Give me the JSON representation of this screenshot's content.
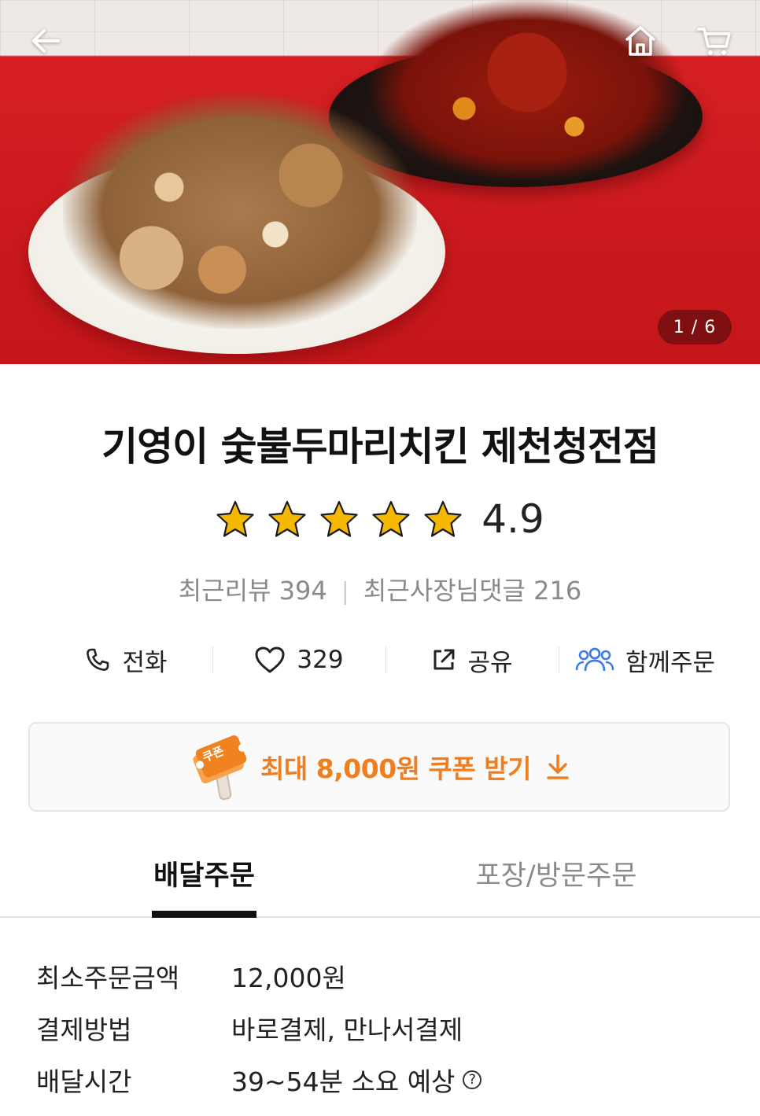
{
  "header": {
    "back_icon": "arrow-left-icon",
    "home_icon": "home-icon",
    "cart_icon": "cart-icon",
    "pager": "1 / 6"
  },
  "store": {
    "name": "기영이 숯불두마리치킨 제천청전점",
    "rating": "4.9",
    "rating_stars": 5,
    "review_label": "최근리뷰 394",
    "owner_reply_label": "최근사장님댓글 216"
  },
  "actions": {
    "call": "전화",
    "like_count": "329",
    "share": "공유",
    "group_order": "함께주문"
  },
  "coupon": {
    "icon_text": "쿠폰",
    "label": "최대 8,000원 쿠폰 받기"
  },
  "tabs": [
    {
      "label": "배달주문",
      "active": true
    },
    {
      "label": "포장/방문주문",
      "active": false
    }
  ],
  "info": [
    {
      "label": "최소주문금액",
      "value": "12,000원"
    },
    {
      "label": "결제방법",
      "value": "바로결제, 만나서결제"
    },
    {
      "label": "배달시간",
      "value": "39~54분 소요 예상"
    }
  ],
  "colors": {
    "accent": "#f07d1e",
    "star": "#f5b800",
    "group_icon": "#3f7ce8"
  }
}
